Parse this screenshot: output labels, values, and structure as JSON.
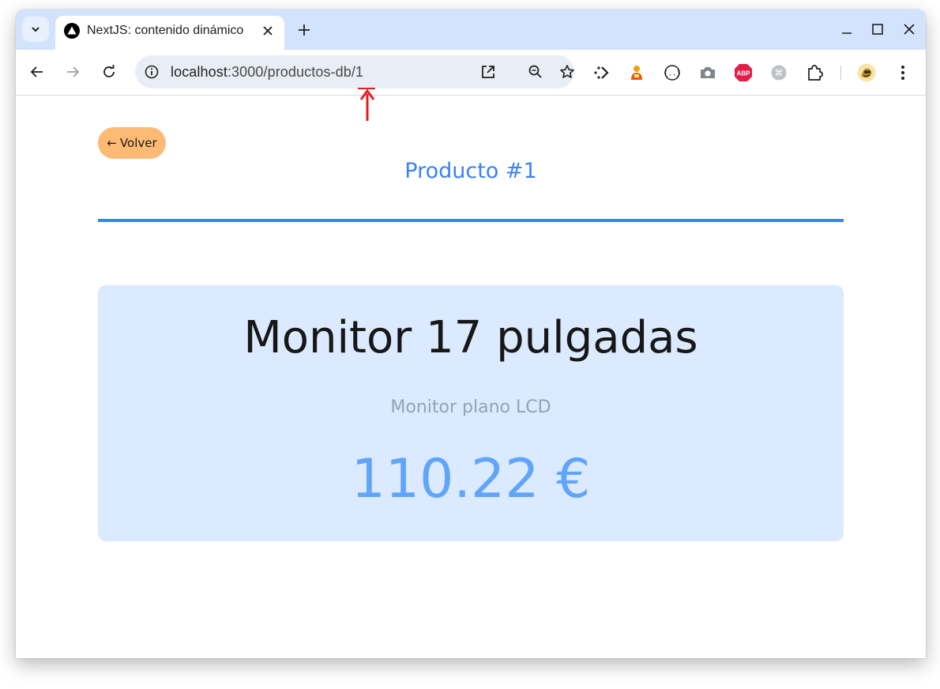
{
  "browser": {
    "tab": {
      "title": "NextJS: contenido dinámico"
    },
    "address_bar": {
      "host": "localhost",
      "path": ":3000/productos-db/1"
    }
  },
  "page": {
    "back_label": "Volver",
    "back_arrow": "←",
    "title": "Producto #1",
    "product": {
      "name": "Monitor 17 pulgadas",
      "description": "Monitor plano LCD",
      "price": "110.22 €"
    }
  },
  "colors": {
    "tabstrip": "#d3e3fd",
    "accent": "#3b82f6",
    "back_button": "#fdba74",
    "card": "#dbeafe",
    "price": "#60a5fa",
    "annotation": "#e02020"
  }
}
